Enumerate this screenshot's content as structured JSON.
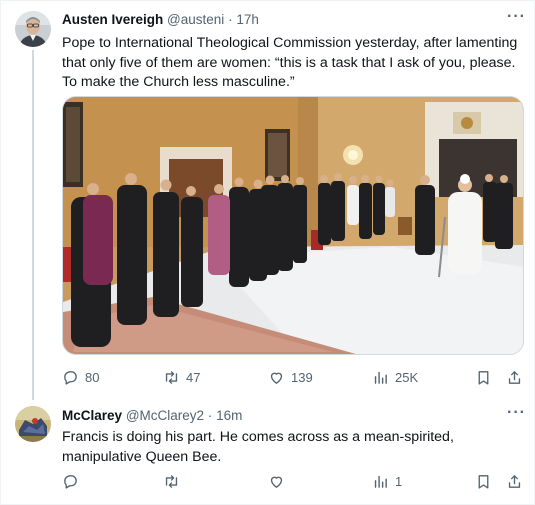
{
  "tweets": [
    {
      "author_name": "Austen Ivereigh",
      "handle": "@austeni",
      "separator": "·",
      "time": "17h",
      "text_lines": [
        "Pope to International Theological Commission yesterday, after lamenting",
        "that only five of them are women: “this is a task that I ask of you, please.",
        "To make the Church less masculine.”"
      ],
      "more": "···",
      "stats": {
        "replies": "80",
        "retweets": "47",
        "likes": "139",
        "views": "25K"
      }
    },
    {
      "author_name": "McClarey",
      "handle": "@McClarey2",
      "separator": "·",
      "time": "16m",
      "text_lines": [
        "Francis is doing his part.  He comes across as a mean-spirited,",
        "manipulative Queen Bee."
      ],
      "more": "···",
      "stats": {
        "replies": "",
        "retweets": "",
        "likes": "",
        "views": "1"
      }
    }
  ],
  "colors": {
    "text": "#0f1419",
    "secondary": "#536471",
    "border": "#cfd9de"
  },
  "icons": [
    "reply-icon",
    "retweet-icon",
    "like-icon",
    "views-icon",
    "bookmark-icon",
    "share-icon",
    "more-icon"
  ]
}
